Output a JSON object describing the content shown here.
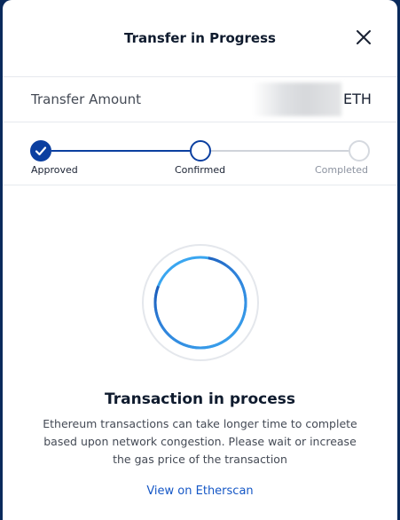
{
  "modal": {
    "title": "Transfer in Progress",
    "close_icon": "close-icon"
  },
  "amount": {
    "label": "Transfer Amount",
    "unit": "ETH"
  },
  "stepper": {
    "steps": [
      {
        "label": "Approved",
        "state": "done"
      },
      {
        "label": "Confirmed",
        "state": "current"
      },
      {
        "label": "Completed",
        "state": "pending"
      }
    ]
  },
  "status": {
    "title": "Transaction in process",
    "text": "Ethereum transactions can take longer time to complete based upon network congestion. Please wait or increase the gas price of the transaction",
    "link_label": "View on Etherscan"
  },
  "colors": {
    "background": "#0a2a5c",
    "accent": "#0b3fa0",
    "spinner_light": "#3aa6f0",
    "link": "#1557c6"
  }
}
